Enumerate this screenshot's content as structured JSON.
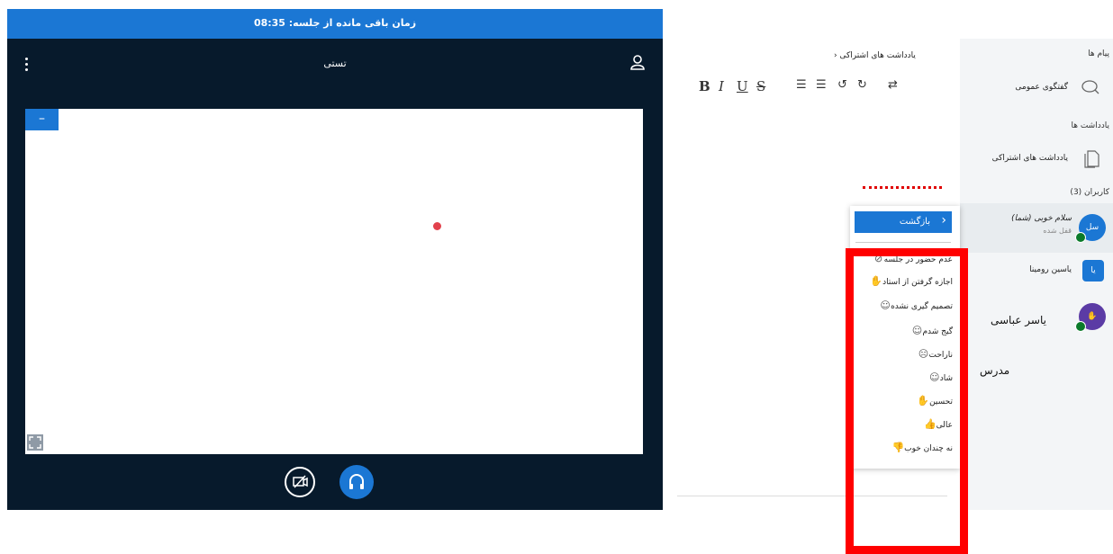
{
  "topbar": {
    "remaining_time": "زمان باقی مانده از جلسه: 08:35"
  },
  "stage": {
    "title": "تستی"
  },
  "notes": {
    "title": "یادداشت های اشتراکی",
    "toolbar": [
      "B",
      "I",
      "U",
      "S",
      "ordered-list",
      "bullet-list",
      "undo",
      "redo",
      "clear"
    ]
  },
  "sidebar": {
    "messages_header": "پیام ها",
    "public_chat": "گفتگوی عمومی",
    "notes_header": "یادداشت ها",
    "shared_notes": "یادداشت های اشتراکی",
    "users_header": "کاربران (3)",
    "users": [
      {
        "name": "سلام خوبی (شما)",
        "status": "قفل شده",
        "initials": "سل",
        "color": "#1b77d4"
      },
      {
        "name": "یاسین رومینا",
        "status": "",
        "initials": "یا",
        "color": "#1b77d4"
      },
      {
        "name": "یاسر عباسی",
        "status": "",
        "initials": "",
        "color": "#5b3ba5"
      }
    ],
    "role_label": "مدرس"
  },
  "status_menu": {
    "back_label": "بازگشت",
    "items": [
      {
        "label": "عدم حضور در جلسه",
        "icon": "clock-icon"
      },
      {
        "label": "اجازه گرفتن از استاد",
        "icon": "raise-hand-icon"
      },
      {
        "label": "تصمیم گیری نشده",
        "icon": "neutral-face-icon"
      },
      {
        "label": "گیج شدم",
        "icon": "confused-face-icon"
      },
      {
        "label": "ناراحت",
        "icon": "sad-face-icon"
      },
      {
        "label": "شاد",
        "icon": "happy-face-icon"
      },
      {
        "label": "تحسین",
        "icon": "applause-icon"
      },
      {
        "label": "عالی",
        "icon": "thumbs-up-icon"
      },
      {
        "label": "نه چندان خوب",
        "icon": "thumbs-down-icon"
      }
    ]
  },
  "colors": {
    "accent": "#1b77d4",
    "stage_bg": "#071a2c",
    "highlight": "#ff0000"
  }
}
